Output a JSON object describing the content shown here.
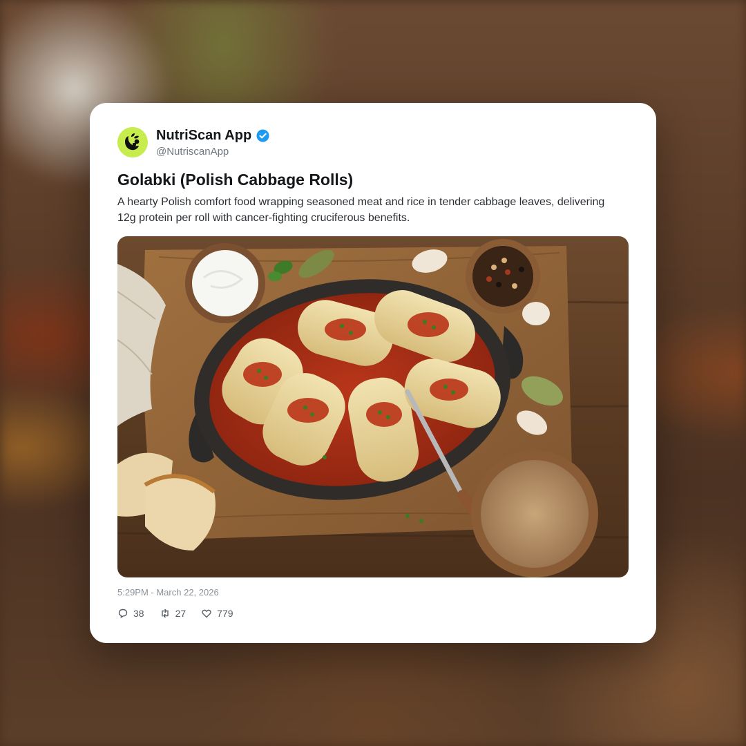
{
  "account": {
    "display_name": "NutriScan App",
    "handle": "@NutriscanApp",
    "verified": true,
    "avatar_color": "#c6ec4e",
    "avatar_icon": "leaf-logo-icon"
  },
  "post": {
    "title": "Golabki (Polish Cabbage Rolls)",
    "description": "A hearty Polish comfort food wrapping seasoned meat and rice in tender cabbage leaves, delivering 12g protein per roll with cancer-fighting cruciferous benefits.",
    "timestamp": "5:29PM - March 22, 2026"
  },
  "actions": {
    "replies": "38",
    "reposts": "27",
    "likes": "779"
  },
  "colors": {
    "verified_badge": "#1d9bf0",
    "text_primary": "#14171a",
    "text_secondary": "#6f7680"
  }
}
